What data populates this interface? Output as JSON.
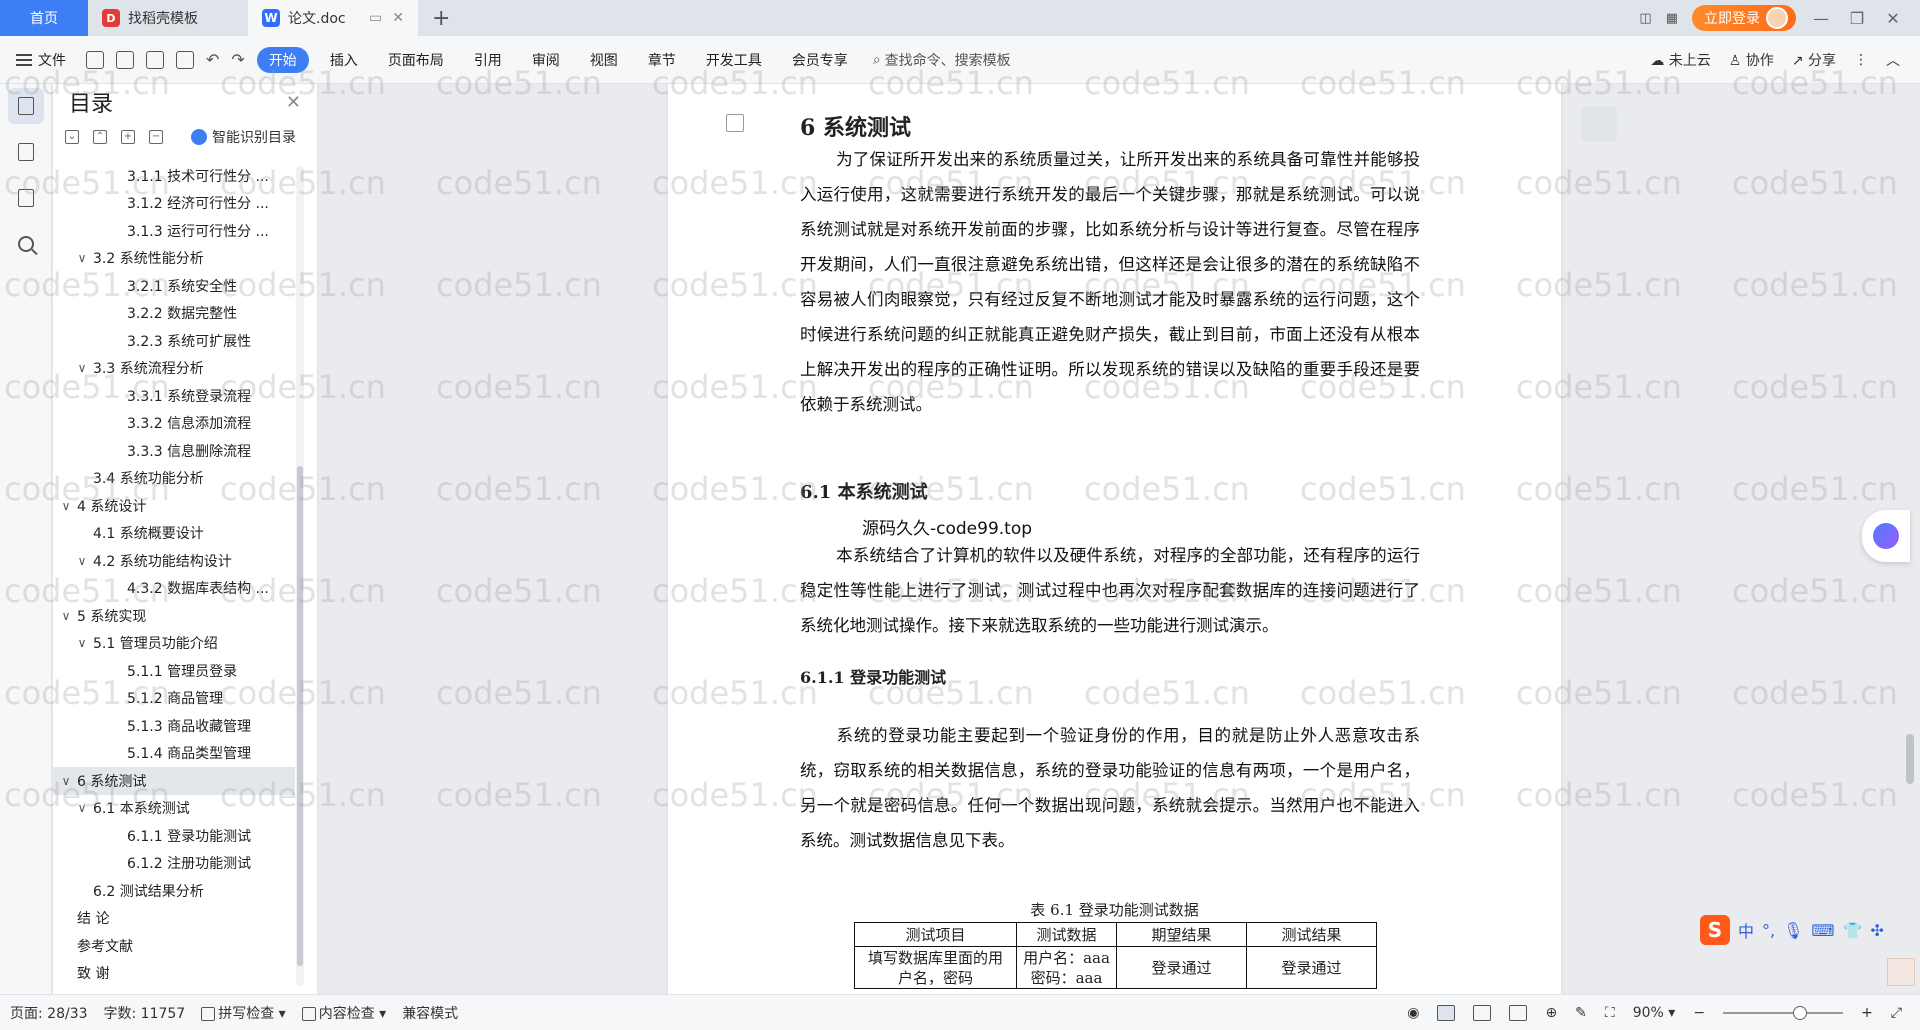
{
  "tabs": {
    "home": "首页",
    "template": "找稻壳模板",
    "doc": "论文.doc",
    "new_tab": "+"
  },
  "titlebar": {
    "login": "立即登录",
    "minimize": "—",
    "restore": "❐",
    "close": "✕"
  },
  "ribbon": {
    "file": "文件",
    "tabs": [
      "开始",
      "插入",
      "页面布局",
      "引用",
      "审阅",
      "视图",
      "章节",
      "开发工具",
      "会员专享"
    ],
    "search": "查找命令、搜索模板",
    "cloud": "未上云",
    "collab": "协作",
    "share": "分享"
  },
  "toc": {
    "title": "目录",
    "smart": "智能识别目录",
    "items": [
      {
        "text": "3.1.1  技术可行性分 ...",
        "level": 3
      },
      {
        "text": "3.1.2  经济可行性分 ...",
        "level": 3
      },
      {
        "text": "3.1.3  运行可行性分 ...",
        "level": 3
      },
      {
        "text": "3.2 系统性能分析",
        "level": 2,
        "caret": true
      },
      {
        "text": "3.2.1  系统安全性",
        "level": 3
      },
      {
        "text": "3.2.2  数据完整性",
        "level": 3
      },
      {
        "text": "3.2.3 系统可扩展性",
        "level": 3
      },
      {
        "text": "3.3 系统流程分析",
        "level": 2,
        "caret": true
      },
      {
        "text": "3.3.1 系统登录流程",
        "level": 3
      },
      {
        "text": "3.3.2 信息添加流程",
        "level": 3
      },
      {
        "text": "3.3.3 信息删除流程",
        "level": 3
      },
      {
        "text": "3.4 系统功能分析",
        "level": 2
      },
      {
        "text": "4  系统设计",
        "level": 1,
        "caret": true
      },
      {
        "text": "4.1 系统概要设计",
        "level": 2
      },
      {
        "text": "4.2 系统功能结构设计",
        "level": 2,
        "caret": true
      },
      {
        "text": "4.3.2  数据库表结构 ...",
        "level": 3
      },
      {
        "text": "5  系统实现",
        "level": 1,
        "caret": true
      },
      {
        "text": "5.1 管理员功能介绍",
        "level": 2,
        "caret": true
      },
      {
        "text": "5.1.1 管理员登录",
        "level": 3
      },
      {
        "text": "5.1.2  商品管理",
        "level": 3
      },
      {
        "text": "5.1.3  商品收藏管理",
        "level": 3
      },
      {
        "text": "5.1.4 商品类型管理",
        "level": 3
      },
      {
        "text": "6 系统测试",
        "level": 1,
        "caret": true,
        "selected": true
      },
      {
        "text": "6.1  本系统测试",
        "level": 2,
        "caret": true
      },
      {
        "text": "6.1.1  登录功能测试",
        "level": 3
      },
      {
        "text": "6.1.2  注册功能测试",
        "level": 3
      },
      {
        "text": "6.2 测试结果分析",
        "level": 2
      },
      {
        "text": "结   论",
        "level": 1
      },
      {
        "text": "参考文献",
        "level": 1
      },
      {
        "text": "致   谢",
        "level": 1
      }
    ]
  },
  "doc": {
    "h1": "6 系统测试",
    "p1": "为了保证所开发出来的系统质量过关，让所开发出来的系统具备可靠性并能够投入运行使用，这就需要进行系统开发的最后一个关键步骤，那就是系统测试。可以说系统测试就是对系统开发前面的步骤，比如系统分析与设计等进行复查。尽管在程序开发期间，人们一直很注意避免系统出错，但这样还是会让很多的潜在的系统缺陷不容易被人们肉眼察觉，只有经过反复不断地测试才能及时暴露系统的运行问题，这个时候进行系统问题的纠正就能真正避免财产损失，截止到目前，市面上还没有从根本上解决开发出的程序的正确性证明。所以发现系统的错误以及缺陷的重要手段还是要依赖于系统测试。",
    "h2": "6.1  本系统测试",
    "code99": "源码久久-code99.top",
    "p2": "本系统结合了计算机的软件以及硬件系统，对程序的全部功能，还有程序的运行稳定性等性能上进行了测试，测试过程中也再次对程序配套数据库的连接问题进行了系统化地测试操作。接下来就选取系统的一些功能进行测试演示。",
    "h3": "6.1.1  登录功能测试",
    "p3": "系统的登录功能主要起到一个验证身份的作用，目的就是防止外人恶意攻击系统，窃取系统的相关数据信息，系统的登录功能验证的信息有两项，一个是用户名，另一个就是密码信息。任何一个数据出现问题，系统就会提示。当然用户也不能进入系统。测试数据信息见下表。",
    "table_caption": "表 6.1  登录功能测试数据",
    "table_headers": [
      "测试项目",
      "测试数据",
      "期望结果",
      "测试结果"
    ],
    "table_row": [
      "填写数据库里面的用户名，密码",
      "用户名：aaa 密码：aaa",
      "登录通过",
      "登录通过"
    ]
  },
  "watermark": "code51.cn",
  "ime": {
    "lang": "中"
  },
  "status": {
    "page": "页面: 28/33",
    "words": "字数: 11757",
    "spell": "拼写检查",
    "content": "内容检查",
    "compat": "兼容模式",
    "zoom": "90%",
    "minus": "−",
    "plus": "+"
  }
}
